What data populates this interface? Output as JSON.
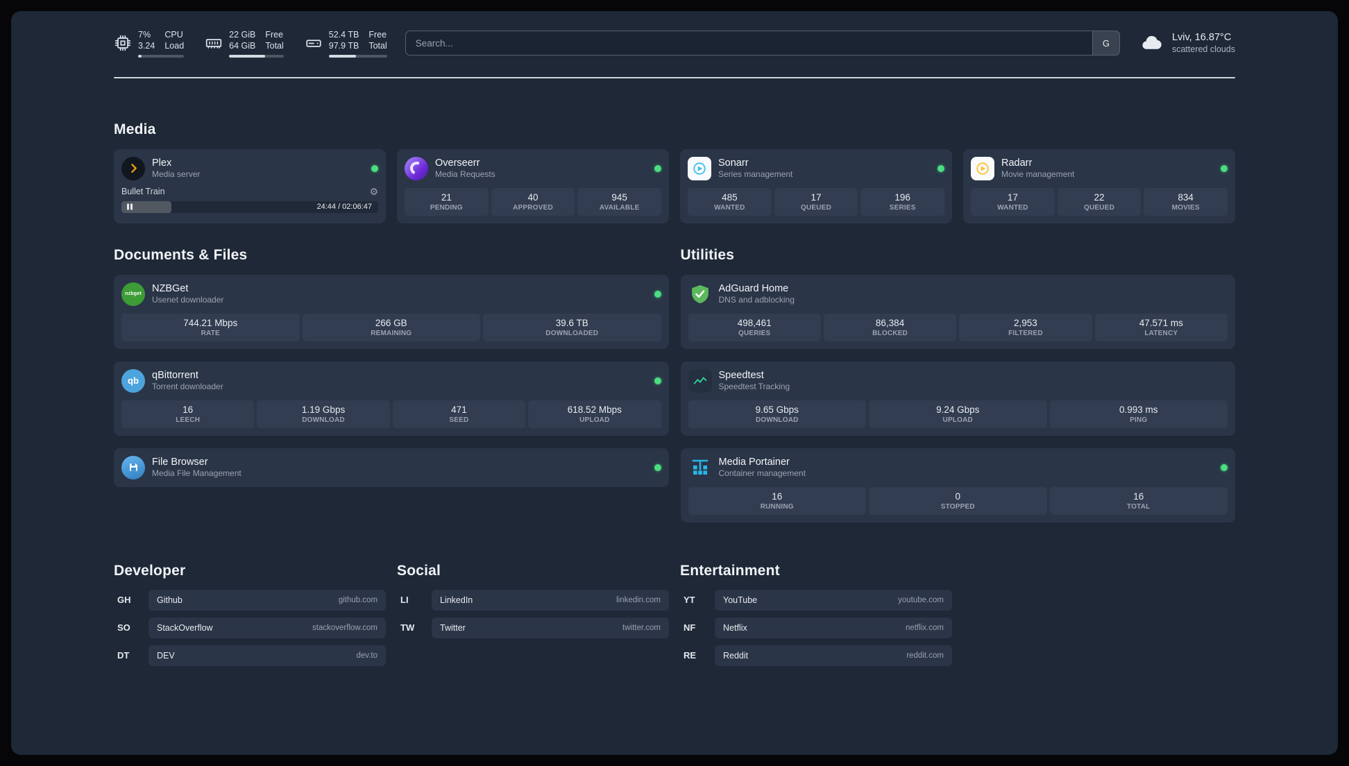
{
  "topbar": {
    "cpu": {
      "value_top": "7%",
      "label_top": "CPU",
      "value_bottom": "3.24",
      "label_bottom": "Load",
      "bar_percent": 7
    },
    "memory": {
      "value_top": "22 GiB",
      "label_top": "Free",
      "value_bottom": "64 GiB",
      "label_bottom": "Total",
      "bar_percent": 66
    },
    "disk": {
      "value_top": "52.4 TB",
      "label_top": "Free",
      "value_bottom": "97.9 TB",
      "label_bottom": "Total",
      "bar_percent": 47
    },
    "search": {
      "placeholder": "Search...",
      "provider_button": "G"
    },
    "weather": {
      "location_temp": "Lviv, 16.87°C",
      "condition": "scattered clouds"
    }
  },
  "groups": {
    "media": {
      "title": "Media",
      "plex": {
        "name": "Plex",
        "description": "Media server",
        "now_playing": "Bullet Train",
        "elapsed_total": "24:44 / 02:06:47",
        "progress_percent": 19.5
      },
      "overseerr": {
        "name": "Overseerr",
        "description": "Media Requests",
        "stats": [
          {
            "value": "21",
            "label": "PENDING"
          },
          {
            "value": "40",
            "label": "APPROVED"
          },
          {
            "value": "945",
            "label": "AVAILABLE"
          }
        ]
      },
      "sonarr": {
        "name": "Sonarr",
        "description": "Series management",
        "stats": [
          {
            "value": "485",
            "label": "WANTED"
          },
          {
            "value": "17",
            "label": "QUEUED"
          },
          {
            "value": "196",
            "label": "SERIES"
          }
        ]
      },
      "radarr": {
        "name": "Radarr",
        "description": "Movie management",
        "stats": [
          {
            "value": "17",
            "label": "WANTED"
          },
          {
            "value": "22",
            "label": "QUEUED"
          },
          {
            "value": "834",
            "label": "MOVIES"
          }
        ]
      }
    },
    "documents": {
      "title": "Documents & Files",
      "nzbget": {
        "name": "NZBGet",
        "description": "Usenet downloader",
        "icon_text": "nzbget",
        "stats": [
          {
            "value": "744.21 Mbps",
            "label": "RATE"
          },
          {
            "value": "266 GB",
            "label": "REMAINING"
          },
          {
            "value": "39.6 TB",
            "label": "DOWNLOADED"
          }
        ]
      },
      "qbittorrent": {
        "name": "qBittorrent",
        "description": "Torrent downloader",
        "icon_text": "qb",
        "stats": [
          {
            "value": "16",
            "label": "LEECH"
          },
          {
            "value": "1.19 Gbps",
            "label": "DOWNLOAD"
          },
          {
            "value": "471",
            "label": "SEED"
          },
          {
            "value": "618.52 Mbps",
            "label": "UPLOAD"
          }
        ]
      },
      "filebrowser": {
        "name": "File Browser",
        "description": "Media File Management"
      }
    },
    "utilities": {
      "title": "Utilities",
      "adguard": {
        "name": "AdGuard Home",
        "description": "DNS and adblocking",
        "stats": [
          {
            "value": "498,461",
            "label": "QUERIES"
          },
          {
            "value": "86,384",
            "label": "BLOCKED"
          },
          {
            "value": "2,953",
            "label": "FILTERED"
          },
          {
            "value": "47.571 ms",
            "label": "LATENCY"
          }
        ]
      },
      "speedtest": {
        "name": "Speedtest",
        "description": "Speedtest Tracking",
        "stats": [
          {
            "value": "9.65 Gbps",
            "label": "DOWNLOAD"
          },
          {
            "value": "9.24 Gbps",
            "label": "UPLOAD"
          },
          {
            "value": "0.993 ms",
            "label": "PING"
          }
        ]
      },
      "portainer": {
        "name": "Media Portainer",
        "description": "Container management",
        "stats": [
          {
            "value": "16",
            "label": "RUNNING"
          },
          {
            "value": "0",
            "label": "STOPPED"
          },
          {
            "value": "16",
            "label": "TOTAL"
          }
        ]
      }
    }
  },
  "bookmarks": {
    "developer": {
      "title": "Developer",
      "items": [
        {
          "abbr": "GH",
          "name": "Github",
          "href": "github.com"
        },
        {
          "abbr": "SO",
          "name": "StackOverflow",
          "href": "stackoverflow.com"
        },
        {
          "abbr": "DT",
          "name": "DEV",
          "href": "dev.to"
        }
      ]
    },
    "social": {
      "title": "Social",
      "items": [
        {
          "abbr": "LI",
          "name": "LinkedIn",
          "href": "linkedin.com"
        },
        {
          "abbr": "TW",
          "name": "Twitter",
          "href": "twitter.com"
        }
      ]
    },
    "entertainment": {
      "title": "Entertainment",
      "items": [
        {
          "abbr": "YT",
          "name": "YouTube",
          "href": "youtube.com"
        },
        {
          "abbr": "NF",
          "name": "Netflix",
          "href": "netflix.com"
        },
        {
          "abbr": "RE",
          "name": "Reddit",
          "href": "reddit.com"
        }
      ]
    }
  },
  "colors": {
    "status_online": "#4ade80",
    "plex_accent": "#e5a00d",
    "sonarr_accent": "#3fbfea",
    "radarr_accent": "#ffc230",
    "adguard_accent": "#5cb85c",
    "speedtest_accent": "#34d399",
    "portainer_accent": "#29b6e8"
  }
}
